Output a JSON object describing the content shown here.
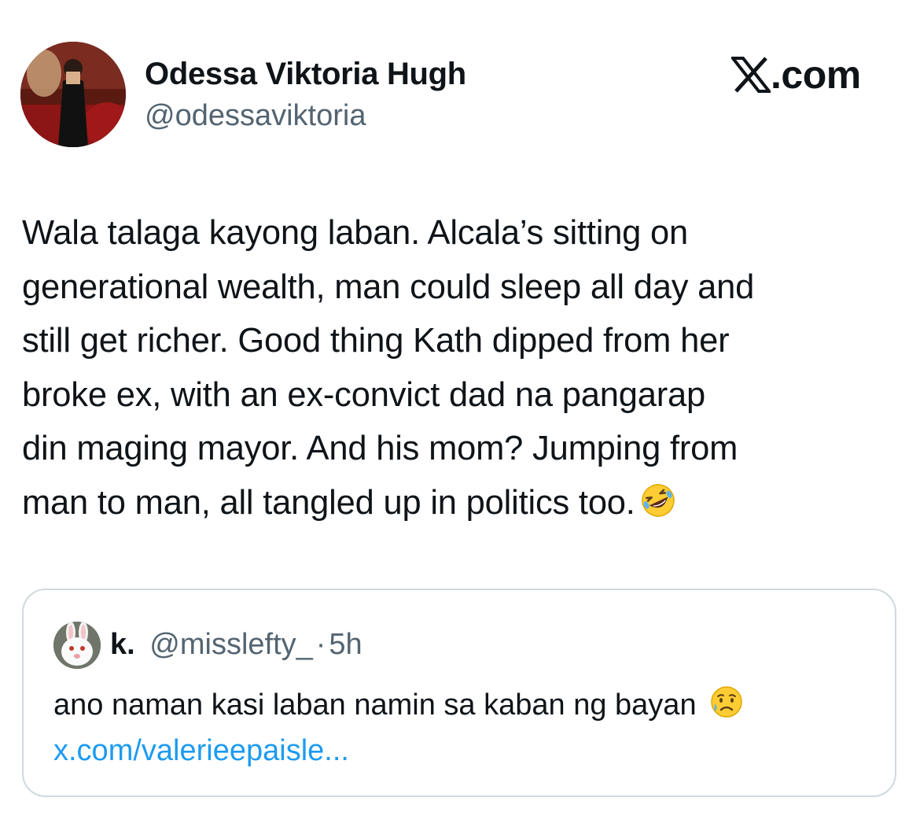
{
  "author": {
    "display_name": "Odessa Viktoria Hugh",
    "handle": "@odessaviktoria",
    "avatar_icon": "profile-photo"
  },
  "brand": {
    "logo_icon": "x-logo-icon",
    "suffix": ".com"
  },
  "tweet": {
    "lines": [
      "Wala talaga kayong laban. Alcala’s sitting on",
      "generational wealth, man could sleep all day and",
      "still get richer. Good thing Kath dipped from her",
      "broke ex, with an ex-convict dad na pangarap",
      "din maging mayor. And his mom? Jumping from",
      "man to man, all tangled up in politics too."
    ],
    "end_emoji": "rolling-on-floor-laughing-emoji"
  },
  "quoted": {
    "name": "k.",
    "handle": "@misslefty_",
    "separator": "·",
    "time": "5h",
    "text": "ano naman kasi laban namin sa kaban ng bayan",
    "end_emoji": "sad-relieved-face-emoji",
    "link": "x.com/valerieepaisle..."
  },
  "colors": {
    "text": "#0f1419",
    "secondary": "#536471",
    "link": "#1d9bf0",
    "border": "#cfd9de"
  }
}
